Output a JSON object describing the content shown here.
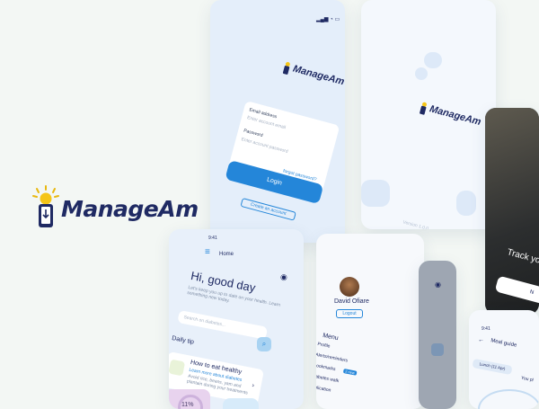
{
  "brand": {
    "name": "ManageAm"
  },
  "login": {
    "logo": "ManageAm",
    "email_label": "Email address",
    "email_placeholder": "Enter account email",
    "password_label": "Password",
    "password_placeholder": "Enter account password",
    "forgot": "forgot password?",
    "login_button": "Login",
    "create_account": "Create an account"
  },
  "splash": {
    "logo": "ManageAm",
    "version": "Version 1.0.0"
  },
  "dark": {
    "text": "Track yo",
    "button": "N"
  },
  "home": {
    "time": "9:41",
    "title": "Home",
    "greeting": "Hi, good day",
    "subtitle": "Let's keep you up to date on your health. Learn something new today.",
    "search_placeholder": "Search on diabetes...",
    "daily_tip": "Daily tip",
    "tip_title": "How to eat healthy",
    "tip_link": "Learn more about diabetes",
    "tip_body": "Avoid rice, beans, yam and plantain during your treatments",
    "progress_label": "11%"
  },
  "menu": {
    "user": "David Ofiare",
    "logout": "Logout",
    "heading": "Menu",
    "items": [
      "Profile",
      "Alerts/reminders",
      "Bookmarks",
      "Diabetes walk",
      "Application"
    ],
    "badge": "2 new"
  },
  "meal": {
    "time": "9:41",
    "title": "Meal guide",
    "chip_1": "Lunch (11 Apr)",
    "chip_2": "You pl"
  }
}
